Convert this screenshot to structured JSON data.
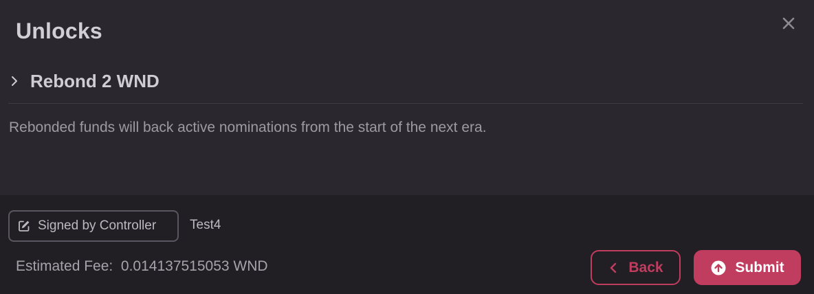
{
  "modal": {
    "title": "Unlocks",
    "close_icon": "close-icon"
  },
  "rebond": {
    "label": "Rebond 2 WND",
    "icon": "chevron-right-icon"
  },
  "description": "Rebonded funds will back active nominations from the start of the next era.",
  "footer": {
    "signer_badge": {
      "label": "Signed by Controller",
      "icon": "edit-icon"
    },
    "account_name": "Test4",
    "fee": {
      "label": "Estimated Fee:",
      "value": "0.014137515053 WND"
    },
    "back_button": {
      "label": "Back",
      "icon": "chevron-left-icon"
    },
    "submit_button": {
      "label": "Submit",
      "icon": "arrow-up-circle-icon"
    }
  },
  "colors": {
    "background": "#2b272e",
    "footer_background": "#221f24",
    "accent": "#c03d5f",
    "text_primary": "#d2cfd4",
    "text_secondary": "#9e9aa2"
  }
}
